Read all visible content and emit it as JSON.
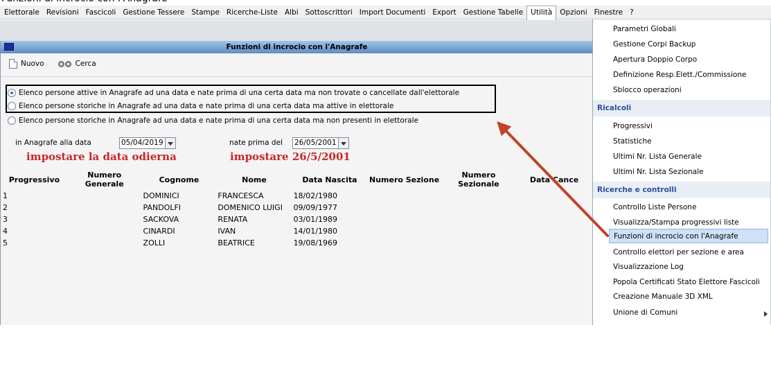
{
  "window_title": "Funzioni di incrocio con l'Anagrafe",
  "menubar": {
    "items": [
      "Elettorale",
      "Revisioni",
      "Fascicoli",
      "Gestione Tessere",
      "Stampe",
      "Ricerche-Liste",
      "Albi",
      "Sottoscrittori",
      "Import Documenti",
      "Export",
      "Gestione Tabelle",
      "Utilità",
      "Opzioni",
      "Finestre",
      "?"
    ],
    "active": "Utilità"
  },
  "toolbar": {
    "new_label": "Nuovo",
    "search_label": "Cerca"
  },
  "options": [
    {
      "label": "Elenco persone attive in Anagrafe ad una data e nate prima di una certa data ma non trovate o cancellate dall'elettorale",
      "selected": true
    },
    {
      "label": "Elenco persone storiche in Anagrafe ad una data e nate prima di una certa data ma attive in elettorale",
      "selected": false
    },
    {
      "label": "Elenco persone storiche in Anagrafe ad una data e nate prima di una certa data ma non presenti in elettorale",
      "selected": false
    }
  ],
  "filters": {
    "date_label": "in Anagrafe alla data",
    "date_value": "05/04/2019",
    "born_label": "nate prima del",
    "born_value": "26/05/2001"
  },
  "annotations": {
    "date_note": "impostare la data odierna",
    "born_note": "impostare 26/5/2001"
  },
  "table": {
    "columns": [
      "Progressivo",
      "Numero Generale",
      "Cognome",
      "Nome",
      "Data Nascita",
      "Numero Sezione",
      "Numero Sezionale",
      "Data Cance"
    ],
    "rows": [
      {
        "progressivo": "1",
        "cognome": "DOMINICI",
        "nome": "FRANCESCA",
        "data_nascita": "18/02/1980"
      },
      {
        "progressivo": "2",
        "cognome": "PANDOLFI",
        "nome": "DOMENICO LUIGI",
        "data_nascita": "09/09/1977"
      },
      {
        "progressivo": "3",
        "cognome": "SACKOVA",
        "nome": "RENATA",
        "data_nascita": "03/01/1989"
      },
      {
        "progressivo": "4",
        "cognome": "CINARDI",
        "nome": "IVAN",
        "data_nascita": "14/01/1980"
      },
      {
        "progressivo": "5",
        "cognome": "ZOLLI",
        "nome": "BEATRICE",
        "data_nascita": "19/08/1969"
      }
    ]
  },
  "utilita_menu": {
    "top_items": [
      "Parametri Globali",
      "Gestione Corpi Backup",
      "Apertura Doppio Corpo",
      "Definizione Resp.Elett./Commissione",
      "Sblocco operazioni"
    ],
    "ricalcoli_label": "Ricalcoli",
    "ricalcoli_items": [
      "Progressivi",
      "Statistiche",
      "Ultimi Nr. Lista Generale",
      "Ultimi Nr. Lista Sezionale"
    ],
    "ricerche_label": "Ricerche e controlli",
    "ricerche_items": [
      "Controllo Liste Persone",
      "Visualizza/Stampa progressivi liste",
      "Funzioni di incrocio con l'Anagrafe",
      "Controllo elettori per sezione e area",
      "Visualizzazione Log",
      "Popola Certificati Stato Elettore Fascicoli",
      "Creazione Manuale 3D XML"
    ],
    "last_item": "Unione di Comuni",
    "active_item": "Funzioni di incrocio con l'Anagrafe"
  },
  "colors": {
    "annotation_red": "#c8262a",
    "arrow": "#c0432a",
    "titlebar": "#5e8dc4"
  }
}
